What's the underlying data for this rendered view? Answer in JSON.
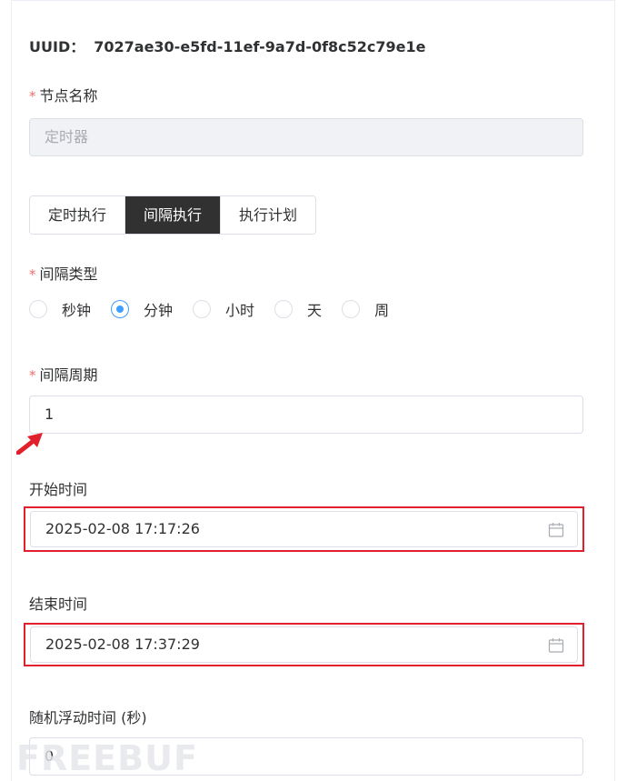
{
  "uuid": {
    "label": "UUID：",
    "value": "7027ae30-e5fd-11ef-9a7d-0f8c52c79e1e"
  },
  "node_name": {
    "required_mark": "*",
    "label": "节点名称",
    "value": "定时器"
  },
  "mode_tabs": [
    {
      "label": "定时执行",
      "active": false
    },
    {
      "label": "间隔执行",
      "active": true
    },
    {
      "label": "执行计划",
      "active": false
    }
  ],
  "interval_type": {
    "required_mark": "*",
    "label": "间隔类型",
    "options": [
      {
        "label": "秒钟",
        "checked": false
      },
      {
        "label": "分钟",
        "checked": true
      },
      {
        "label": "小时",
        "checked": false
      },
      {
        "label": "天",
        "checked": false
      },
      {
        "label": "周",
        "checked": false
      }
    ]
  },
  "interval_period": {
    "required_mark": "*",
    "label": "间隔周期",
    "value": "1"
  },
  "start_time": {
    "label": "开始时间",
    "value": "2025-02-08 17:17:26"
  },
  "end_time": {
    "label": "结束时间",
    "value": "2025-02-08 17:37:29"
  },
  "random_float": {
    "label": "随机浮动时间 (秒)",
    "value": "0"
  },
  "watermark": "FREEBUF",
  "colors": {
    "required": "#f56c6c",
    "active_tab_bg": "#313131",
    "radio_accent": "#409eff",
    "highlight_box": "#e0202b"
  }
}
